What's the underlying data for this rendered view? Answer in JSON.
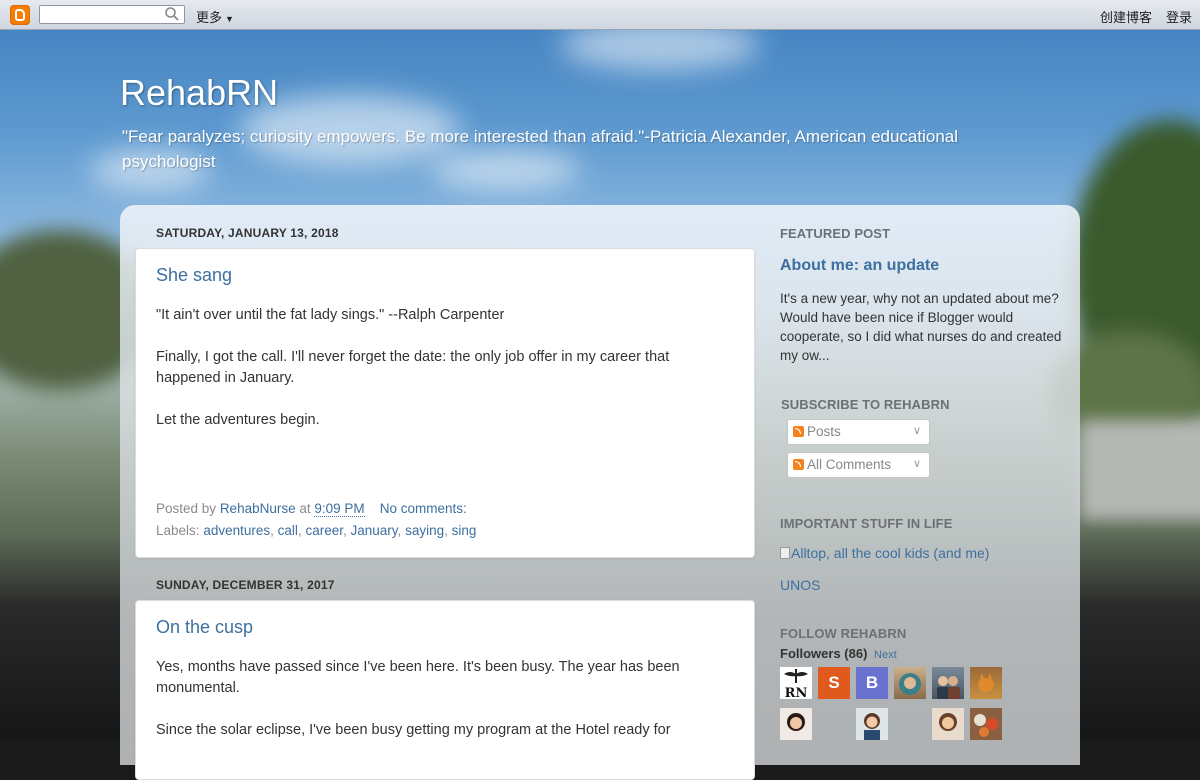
{
  "navbar": {
    "search_placeholder": "",
    "more_label": "更多",
    "create_blog": "创建博客",
    "login": "登录"
  },
  "header": {
    "title": "RehabRN",
    "description": "\"Fear paralyzes; curiosity empowers. Be more interested than afraid.\"-Patricia Alexander, American educational psychologist"
  },
  "posts": [
    {
      "date": "SATURDAY, JANUARY 13, 2018",
      "title": "She sang",
      "paragraphs": [
        "\"It ain't over until the fat lady sings.\" --Ralph Carpenter",
        "Finally, I got the call. I'll never forget the date: the only job offer in my career that happened in January.",
        "Let the adventures begin."
      ],
      "posted_by_label": "Posted by",
      "author": "RehabNurse",
      "at_label": "at",
      "time": "9:09 PM",
      "comments": "No comments:",
      "labels_label": "Labels:",
      "labels": [
        "adventures",
        "call",
        "career",
        "January",
        "saying",
        "sing"
      ]
    },
    {
      "date": "SUNDAY, DECEMBER 31, 2017",
      "title": "On the cusp",
      "paragraphs": [
        "Yes, months have passed since I've been here. It's been busy. The year has been monumental.",
        "Since the solar eclipse, I've been busy getting my program at the Hotel ready for"
      ]
    }
  ],
  "sidebar": {
    "featured": {
      "heading": "FEATURED POST",
      "title": "About me: an update",
      "snippet": "It's a new year, why not an updated about me? Would have been nice if Blogger would cooperate, so I did what nurses do and created my ow..."
    },
    "subscribe": {
      "heading": "SUBSCRIBE TO REHABRN",
      "posts": "Posts",
      "comments": "All Comments"
    },
    "important": {
      "heading": "IMPORTANT STUFF IN LIFE",
      "alltop": "Alltop, all the cool kids (and me)",
      "unos": "UNOS"
    },
    "follow": {
      "heading": "FOLLOW REHABRN",
      "followers": "Followers (86)",
      "next": "Next",
      "avatars": [
        {
          "name": "rn-logo-avatar",
          "letter": "RN"
        },
        {
          "name": "s-avatar",
          "letter": "S",
          "color": "#e05a1e"
        },
        {
          "name": "b-avatar",
          "letter": "B",
          "color": "#6a72d0"
        },
        {
          "name": "hijab-woman-avatar",
          "letter": ""
        },
        {
          "name": "couple-avatar",
          "letter": ""
        },
        {
          "name": "cat-avatar",
          "letter": ""
        },
        {
          "name": "woman-avatar-1",
          "letter": ""
        },
        {
          "name": "woman-avatar-2",
          "letter": ""
        },
        {
          "name": "vintage-woman-avatar",
          "letter": ""
        },
        {
          "name": "flowers-avatar",
          "letter": ""
        }
      ]
    }
  },
  "colors": {
    "link": "#3d6fa0",
    "blogger_orange": "#f57d00"
  }
}
